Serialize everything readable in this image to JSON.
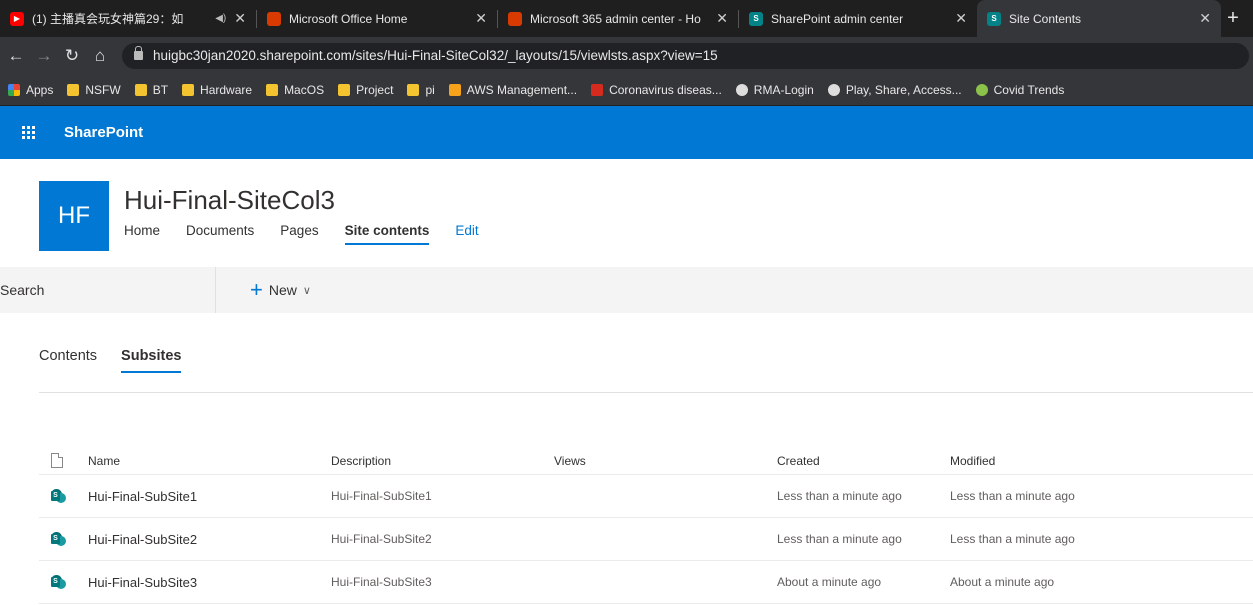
{
  "browser": {
    "tabs": [
      {
        "title": "(1) 主播真会玩女神篇29：如",
        "favicon_color": "#ff0000",
        "active": false
      },
      {
        "title": "Microsoft Office Home",
        "favicon_color": "#d83b01",
        "active": false
      },
      {
        "title": "Microsoft 365 admin center - Ho",
        "favicon_color": "#d83b01",
        "active": false
      },
      {
        "title": "SharePoint admin center",
        "favicon_color": "#038387",
        "active": false
      },
      {
        "title": "Site Contents",
        "favicon_color": "#038387",
        "active": true
      }
    ],
    "url": "huigbc30jan2020.sharepoint.com/sites/Hui-Final-SiteCol32/_layouts/15/viewlsts.aspx?view=15",
    "bookmarks": [
      "Apps",
      "NSFW",
      "BT",
      "Hardware",
      "MacOS",
      "Project",
      "pi",
      "AWS Management...",
      "Coronavirus diseas...",
      "RMA-Login",
      "Play, Share, Access...",
      "Covid Trends"
    ]
  },
  "suite": {
    "title": "SharePoint"
  },
  "site": {
    "logo": "HF",
    "title": "Hui-Final-SiteCol3",
    "nav": [
      "Home",
      "Documents",
      "Pages",
      "Site contents",
      "Edit"
    ]
  },
  "commandbar": {
    "search_label": "Search",
    "new_label": "New"
  },
  "pivots": [
    "Contents",
    "Subsites"
  ],
  "table": {
    "columns": [
      "Name",
      "Description",
      "Views",
      "Created",
      "Modified"
    ],
    "rows": [
      {
        "name": "Hui-Final-SubSite1",
        "description": "Hui-Final-SubSite1",
        "views": "",
        "created": "Less than a minute ago",
        "modified": "Less than a minute ago"
      },
      {
        "name": "Hui-Final-SubSite2",
        "description": "Hui-Final-SubSite2",
        "views": "",
        "created": "Less than a minute ago",
        "modified": "Less than a minute ago"
      },
      {
        "name": "Hui-Final-SubSite3",
        "description": "Hui-Final-SubSite3",
        "views": "",
        "created": "About a minute ago",
        "modified": "About a minute ago"
      }
    ]
  }
}
